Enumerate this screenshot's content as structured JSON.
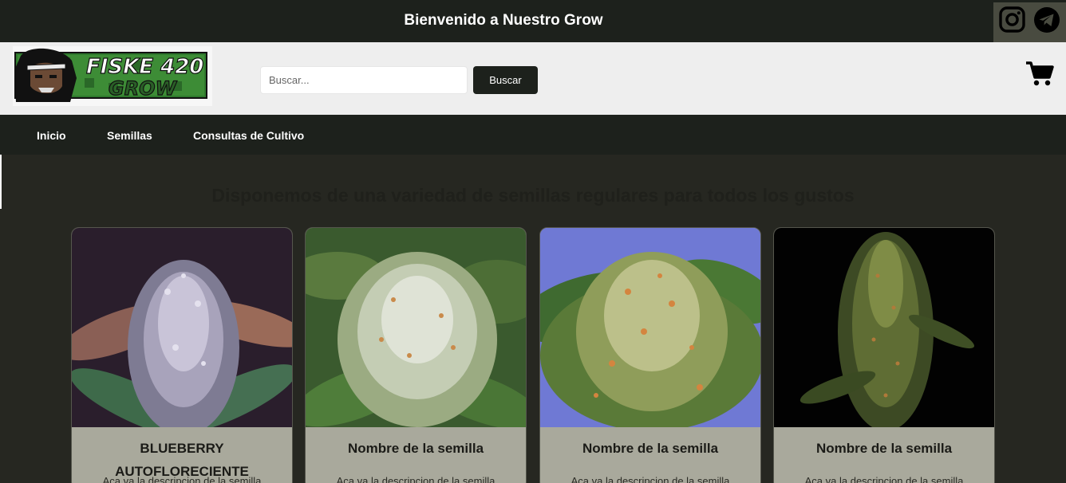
{
  "topbar": {
    "title": "Bienvenido a Nuestro Grow",
    "social": [
      "instagram-icon",
      "telegram-icon"
    ]
  },
  "header": {
    "logo_text_line1": "FISKE 420",
    "logo_text_line2": "GROW",
    "search_placeholder": "Buscar...",
    "search_button": "Buscar",
    "cart_icon": "cart-icon"
  },
  "nav": {
    "items": [
      {
        "label": "Inicio"
      },
      {
        "label": "Semillas"
      },
      {
        "label": "Consultas de Cultivo"
      }
    ]
  },
  "main": {
    "title": "Disponemos de una variedad de semillas regulares para todos los gustos",
    "cards": [
      {
        "name": "BLUEBERRY AUTOFLORECIENTE",
        "desc": "Aca va la descripcion de la semilla"
      },
      {
        "name": "Nombre de la semilla",
        "desc": "Aca va la descripcion de la semilla"
      },
      {
        "name": "Nombre de la semilla",
        "desc": "Aca va la descripcion de la semilla"
      },
      {
        "name": "Nombre de la semilla",
        "desc": "Aca va la descripcion de la semilla"
      }
    ]
  },
  "colors": {
    "dark": "#1d211c",
    "header_bg": "#eeeeee",
    "page_bg": "#262721",
    "card_bg": "#a9a99c"
  }
}
